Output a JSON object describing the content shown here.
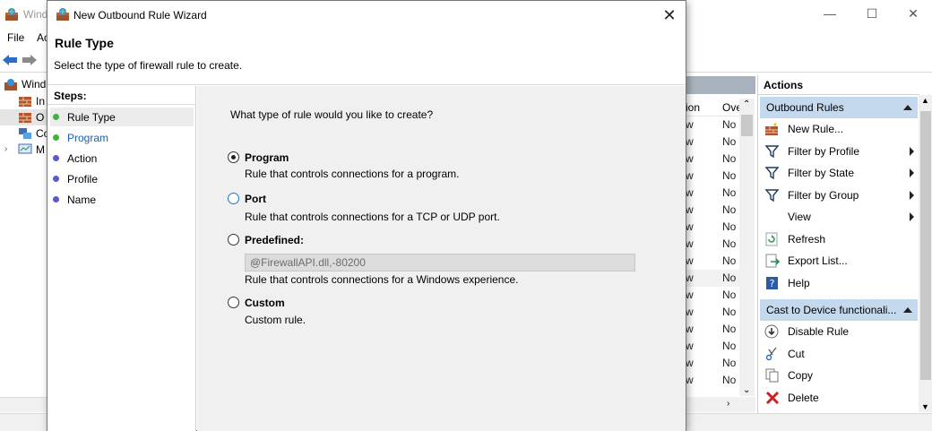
{
  "background_window": {
    "title": "Windo",
    "menu": [
      "File",
      "Ac"
    ],
    "tree": [
      {
        "label": "Windo",
        "icon": "firewall-icon"
      },
      {
        "label": "In",
        "icon": "inbound-rules-icon"
      },
      {
        "label": "O",
        "icon": "outbound-rules-icon"
      },
      {
        "label": "Co",
        "icon": "connection-security-icon"
      },
      {
        "label": "M",
        "icon": "monitoring-icon"
      }
    ],
    "list": {
      "columns": [
        "ion",
        "Ove"
      ],
      "rows": [
        {
          "a": "w",
          "b": "No"
        },
        {
          "a": "w",
          "b": "No"
        },
        {
          "a": "w",
          "b": "No"
        },
        {
          "a": "w",
          "b": "No"
        },
        {
          "a": "w",
          "b": "No"
        },
        {
          "a": "w",
          "b": "No"
        },
        {
          "a": "w",
          "b": "No"
        },
        {
          "a": "w",
          "b": "No"
        },
        {
          "a": "w",
          "b": "No"
        },
        {
          "a": "w",
          "b": "No"
        },
        {
          "a": "w",
          "b": "No"
        },
        {
          "a": "w",
          "b": "No"
        },
        {
          "a": "w",
          "b": "No"
        },
        {
          "a": "w",
          "b": "No"
        },
        {
          "a": "w",
          "b": "No"
        },
        {
          "a": "w",
          "b": "No"
        }
      ]
    }
  },
  "actions": {
    "title": "Actions",
    "group1": "Outbound Rules",
    "items1": [
      {
        "label": "New Rule...",
        "icon": "new-rule-icon",
        "submenu": false
      },
      {
        "label": "Filter by Profile",
        "icon": "filter-icon",
        "submenu": true
      },
      {
        "label": "Filter by State",
        "icon": "filter-icon",
        "submenu": true
      },
      {
        "label": "Filter by Group",
        "icon": "filter-icon",
        "submenu": true
      },
      {
        "label": "View",
        "icon": "",
        "submenu": true
      },
      {
        "label": "Refresh",
        "icon": "refresh-icon",
        "submenu": false
      },
      {
        "label": "Export List...",
        "icon": "export-icon",
        "submenu": false
      },
      {
        "label": "Help",
        "icon": "help-icon",
        "submenu": false
      }
    ],
    "group2": "Cast to Device functionali...",
    "items2": [
      {
        "label": "Disable Rule",
        "icon": "disable-icon"
      },
      {
        "label": "Cut",
        "icon": "cut-icon"
      },
      {
        "label": "Copy",
        "icon": "copy-icon"
      },
      {
        "label": "Delete",
        "icon": "delete-icon"
      }
    ]
  },
  "wizard": {
    "title": "New Outbound Rule Wizard",
    "heading": "Rule Type",
    "subheading": "Select the type of firewall rule to create.",
    "steps_title": "Steps:",
    "steps": [
      {
        "label": "Rule Type",
        "state": "current"
      },
      {
        "label": "Program",
        "state": "link"
      },
      {
        "label": "Action",
        "state": "pending"
      },
      {
        "label": "Profile",
        "state": "pending"
      },
      {
        "label": "Name",
        "state": "pending"
      }
    ],
    "question": "What type of rule would you like to create?",
    "options": [
      {
        "label": "Program",
        "desc": "Rule that controls connections for a program.",
        "selected": true
      },
      {
        "label": "Port",
        "desc": "Rule that controls connections for a TCP or UDP port.",
        "selected": false
      },
      {
        "label": "Predefined:",
        "desc": "Rule that controls connections for a Windows experience.",
        "selected": false,
        "combo": "@FirewallAPI.dll,-80200"
      },
      {
        "label": "Custom",
        "desc": "Custom rule.",
        "selected": false
      }
    ],
    "colors": {
      "dot_done": "#3fb33f",
      "dot_pending": "#5a5ad0",
      "link": "#1a5fb4",
      "group_bg": "#c4d9ee"
    }
  }
}
